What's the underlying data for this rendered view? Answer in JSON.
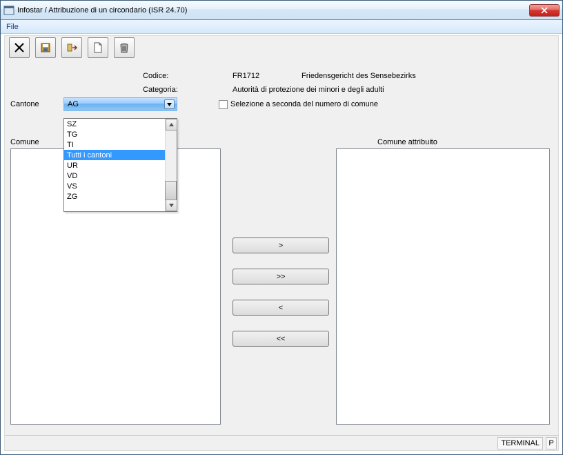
{
  "window": {
    "title": "Infostar / Attribuzione di un circondario (ISR 24.70)"
  },
  "menu": {
    "file": "File"
  },
  "labels": {
    "codice": "Codice:",
    "categoria": "Categoria:",
    "cantone": "Cantone",
    "comune": "Comune",
    "comune_attribuito": "Comune attribuito",
    "checkbox": "Selezione a seconda del numero di comune"
  },
  "values": {
    "codice": "FR1712",
    "codice_desc": "Friedensgericht des Sensebezirks",
    "categoria": "Autorità di protezione dei minori e degli adulti",
    "cantone_selected": "AG"
  },
  "dropdown_items": [
    "SZ",
    "TG",
    "TI",
    "Tutti i cantoni",
    "UR",
    "VD",
    "VS",
    "ZG"
  ],
  "dropdown_selected_index": 3,
  "buttons": {
    "add": ">",
    "add_all": ">>",
    "remove": "<",
    "remove_all": "<<"
  },
  "status": {
    "terminal": "TERMINAL",
    "p": "P"
  }
}
